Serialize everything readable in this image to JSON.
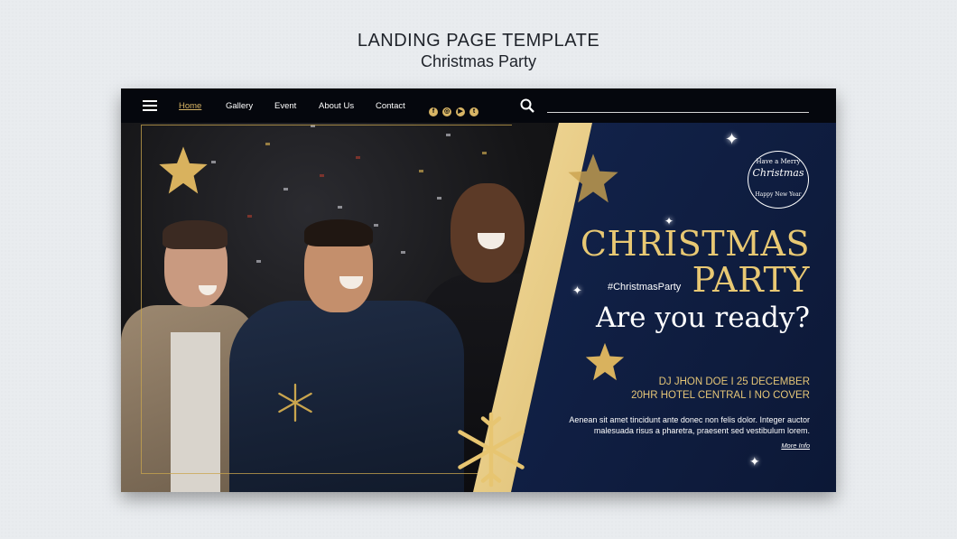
{
  "header": {
    "title": "LANDING PAGE TEMPLATE",
    "subtitle": "Christmas Party"
  },
  "nav": {
    "menu_icon": "hamburger-menu-icon",
    "links": [
      "Home",
      "Gallery",
      "Event",
      "About Us",
      "Contact"
    ],
    "active": "Home",
    "social_icons": [
      "facebook-icon",
      "instagram-icon",
      "youtube-icon",
      "twitter-icon"
    ],
    "search_icon": "search-icon"
  },
  "badge": {
    "line1": "Have a Merry",
    "line2": "Christmas",
    "line3": "Happy New Year"
  },
  "hero": {
    "title_line1": "CHRISTMAS",
    "title_line2": "PARTY",
    "hashtag": "#ChristmasParty",
    "tagline": "Are you ready?",
    "event_line1": "DJ JHON DOE   I   25 DECEMBER",
    "event_line2": "20HR   HOTEL CENTRAL   I   NO COVER",
    "description": "Aenean sit amet tincidunt ante donec non felis dolor. Integer auctor malesuada risus a pharetra, praesent sed vestibulum lorem.",
    "more_link": "More Info"
  },
  "colors": {
    "gold": "#e8c873",
    "navy": "#13244d",
    "nav_bg": "#05070d"
  }
}
